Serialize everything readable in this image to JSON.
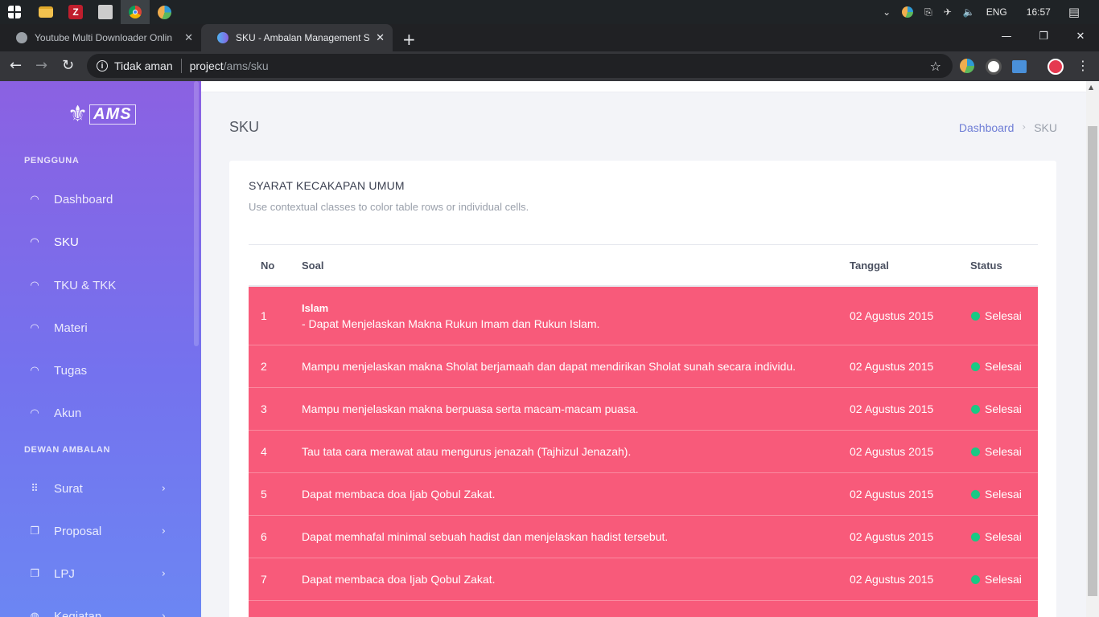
{
  "taskbar": {
    "language": "ENG",
    "time": "16:57"
  },
  "browser": {
    "tabs": [
      {
        "title": "Youtube Multi Downloader Onlin",
        "active": false
      },
      {
        "title": "SKU - Ambalan Management Sys",
        "active": true
      }
    ],
    "security_label": "Tidak aman",
    "url_host": "project",
    "url_path": "/ams/sku"
  },
  "sidebar": {
    "logo_text": "AMS",
    "section_pengguna": "PENGGUNA",
    "pengguna_items": [
      {
        "label": "Dashboard",
        "icon": "gauge-icon"
      },
      {
        "label": "SKU",
        "icon": "gauge-icon",
        "active": true
      },
      {
        "label": "TKU & TKK",
        "icon": "gauge-icon"
      },
      {
        "label": "Materi",
        "icon": "gauge-icon"
      },
      {
        "label": "Tugas",
        "icon": "gauge-icon"
      },
      {
        "label": "Akun",
        "icon": "gauge-icon"
      }
    ],
    "section_dewan": "DEWAN AMBALAN",
    "dewan_items": [
      {
        "label": "Surat",
        "icon": "grid-icon"
      },
      {
        "label": "Proposal",
        "icon": "copy-icon"
      },
      {
        "label": "LPJ",
        "icon": "copy-icon"
      },
      {
        "label": "Kegiatan",
        "icon": "globe-icon"
      }
    ]
  },
  "page": {
    "title": "SKU",
    "breadcrumb": {
      "home": "Dashboard",
      "current": "SKU"
    }
  },
  "card": {
    "title": "SYARAT KECAKAPAN UMUM",
    "subtitle": "Use contextual classes to color table rows or individual cells.",
    "columns": {
      "no": "No",
      "soal": "Soal",
      "tanggal": "Tanggal",
      "status": "Status"
    },
    "rows": [
      {
        "no": "1",
        "heading": "Islam",
        "soal": "- Dapat Menjelaskan Makna Rukun Imam dan Rukun Islam.",
        "tanggal": "02 Agustus 2015",
        "status": "Selesai"
      },
      {
        "no": "2",
        "soal": "Mampu menjelaskan makna Sholat berjamaah dan dapat mendirikan Sholat sunah secara individu.",
        "tanggal": "02 Agustus 2015",
        "status": "Selesai"
      },
      {
        "no": "3",
        "soal": "Mampu menjelaskan makna berpuasa serta macam-macam puasa.",
        "tanggal": "02 Agustus 2015",
        "status": "Selesai"
      },
      {
        "no": "4",
        "soal": "Tau tata cara merawat atau mengurus jenazah (Tajhizul Jenazah).",
        "tanggal": "02 Agustus 2015",
        "status": "Selesai"
      },
      {
        "no": "5",
        "soal": "Dapat membaca doa Ijab Qobul Zakat.",
        "tanggal": "02 Agustus 2015",
        "status": "Selesai"
      },
      {
        "no": "6",
        "soal": "Dapat memhafal minimal sebuah hadist dan menjelaskan hadist tersebut.",
        "tanggal": "02 Agustus 2015",
        "status": "Selesai"
      },
      {
        "no": "7",
        "soal": "Dapat membaca doa Ijab Qobul Zakat.",
        "tanggal": "02 Agustus 2015",
        "status": "Selesai"
      }
    ]
  },
  "colors": {
    "row_bg": "#f85a7a",
    "status_dot": "#19c984",
    "sidebar_top": "#8b61e2",
    "sidebar_bottom": "#6c86f3"
  }
}
